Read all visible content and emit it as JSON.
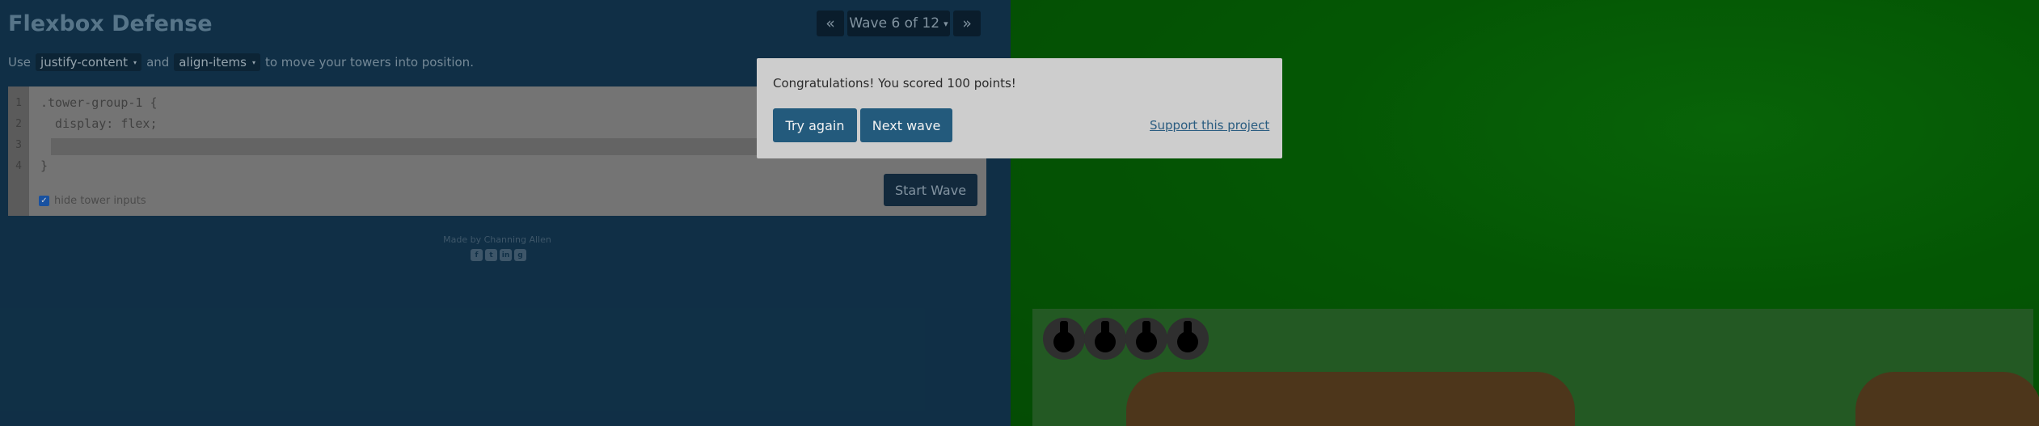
{
  "app": {
    "title": "Flexbox Defense"
  },
  "wave_nav": {
    "prev_icon": "«",
    "current": "Wave 6 of 12",
    "caret": "▾",
    "next_icon": "»"
  },
  "instructions": {
    "use": "Use",
    "prop1": "justify-content",
    "and": "and",
    "prop2": "align-items",
    "suffix": "to move your towers into position.",
    "caret": "▾"
  },
  "editor": {
    "line_numbers": [
      "1",
      "2",
      "3",
      "4"
    ],
    "line1": ".tower-group-1 {",
    "line2": "  display: flex;",
    "line3_value": "",
    "line4": "}",
    "hide_label": "hide tower inputs",
    "hide_checked": true,
    "start_button": "Start Wave"
  },
  "footer": {
    "credit": "Made by Channing Allen",
    "socials": [
      "facebook-icon",
      "twitter-icon",
      "linkedin-icon",
      "github-icon"
    ]
  },
  "board": {
    "towers_count": 4,
    "colors": {
      "grass": "#066a06",
      "placement": "#2b6d2b",
      "path": "#5e4222"
    }
  },
  "modal": {
    "message": "Congratulations! You scored 100 points!",
    "try_again": "Try again",
    "next_wave": "Next wave",
    "support": "Support this project"
  },
  "colors": {
    "left_bg": "#143a56",
    "accent": "#235a7c",
    "modal_bg": "#cdcdcd"
  }
}
